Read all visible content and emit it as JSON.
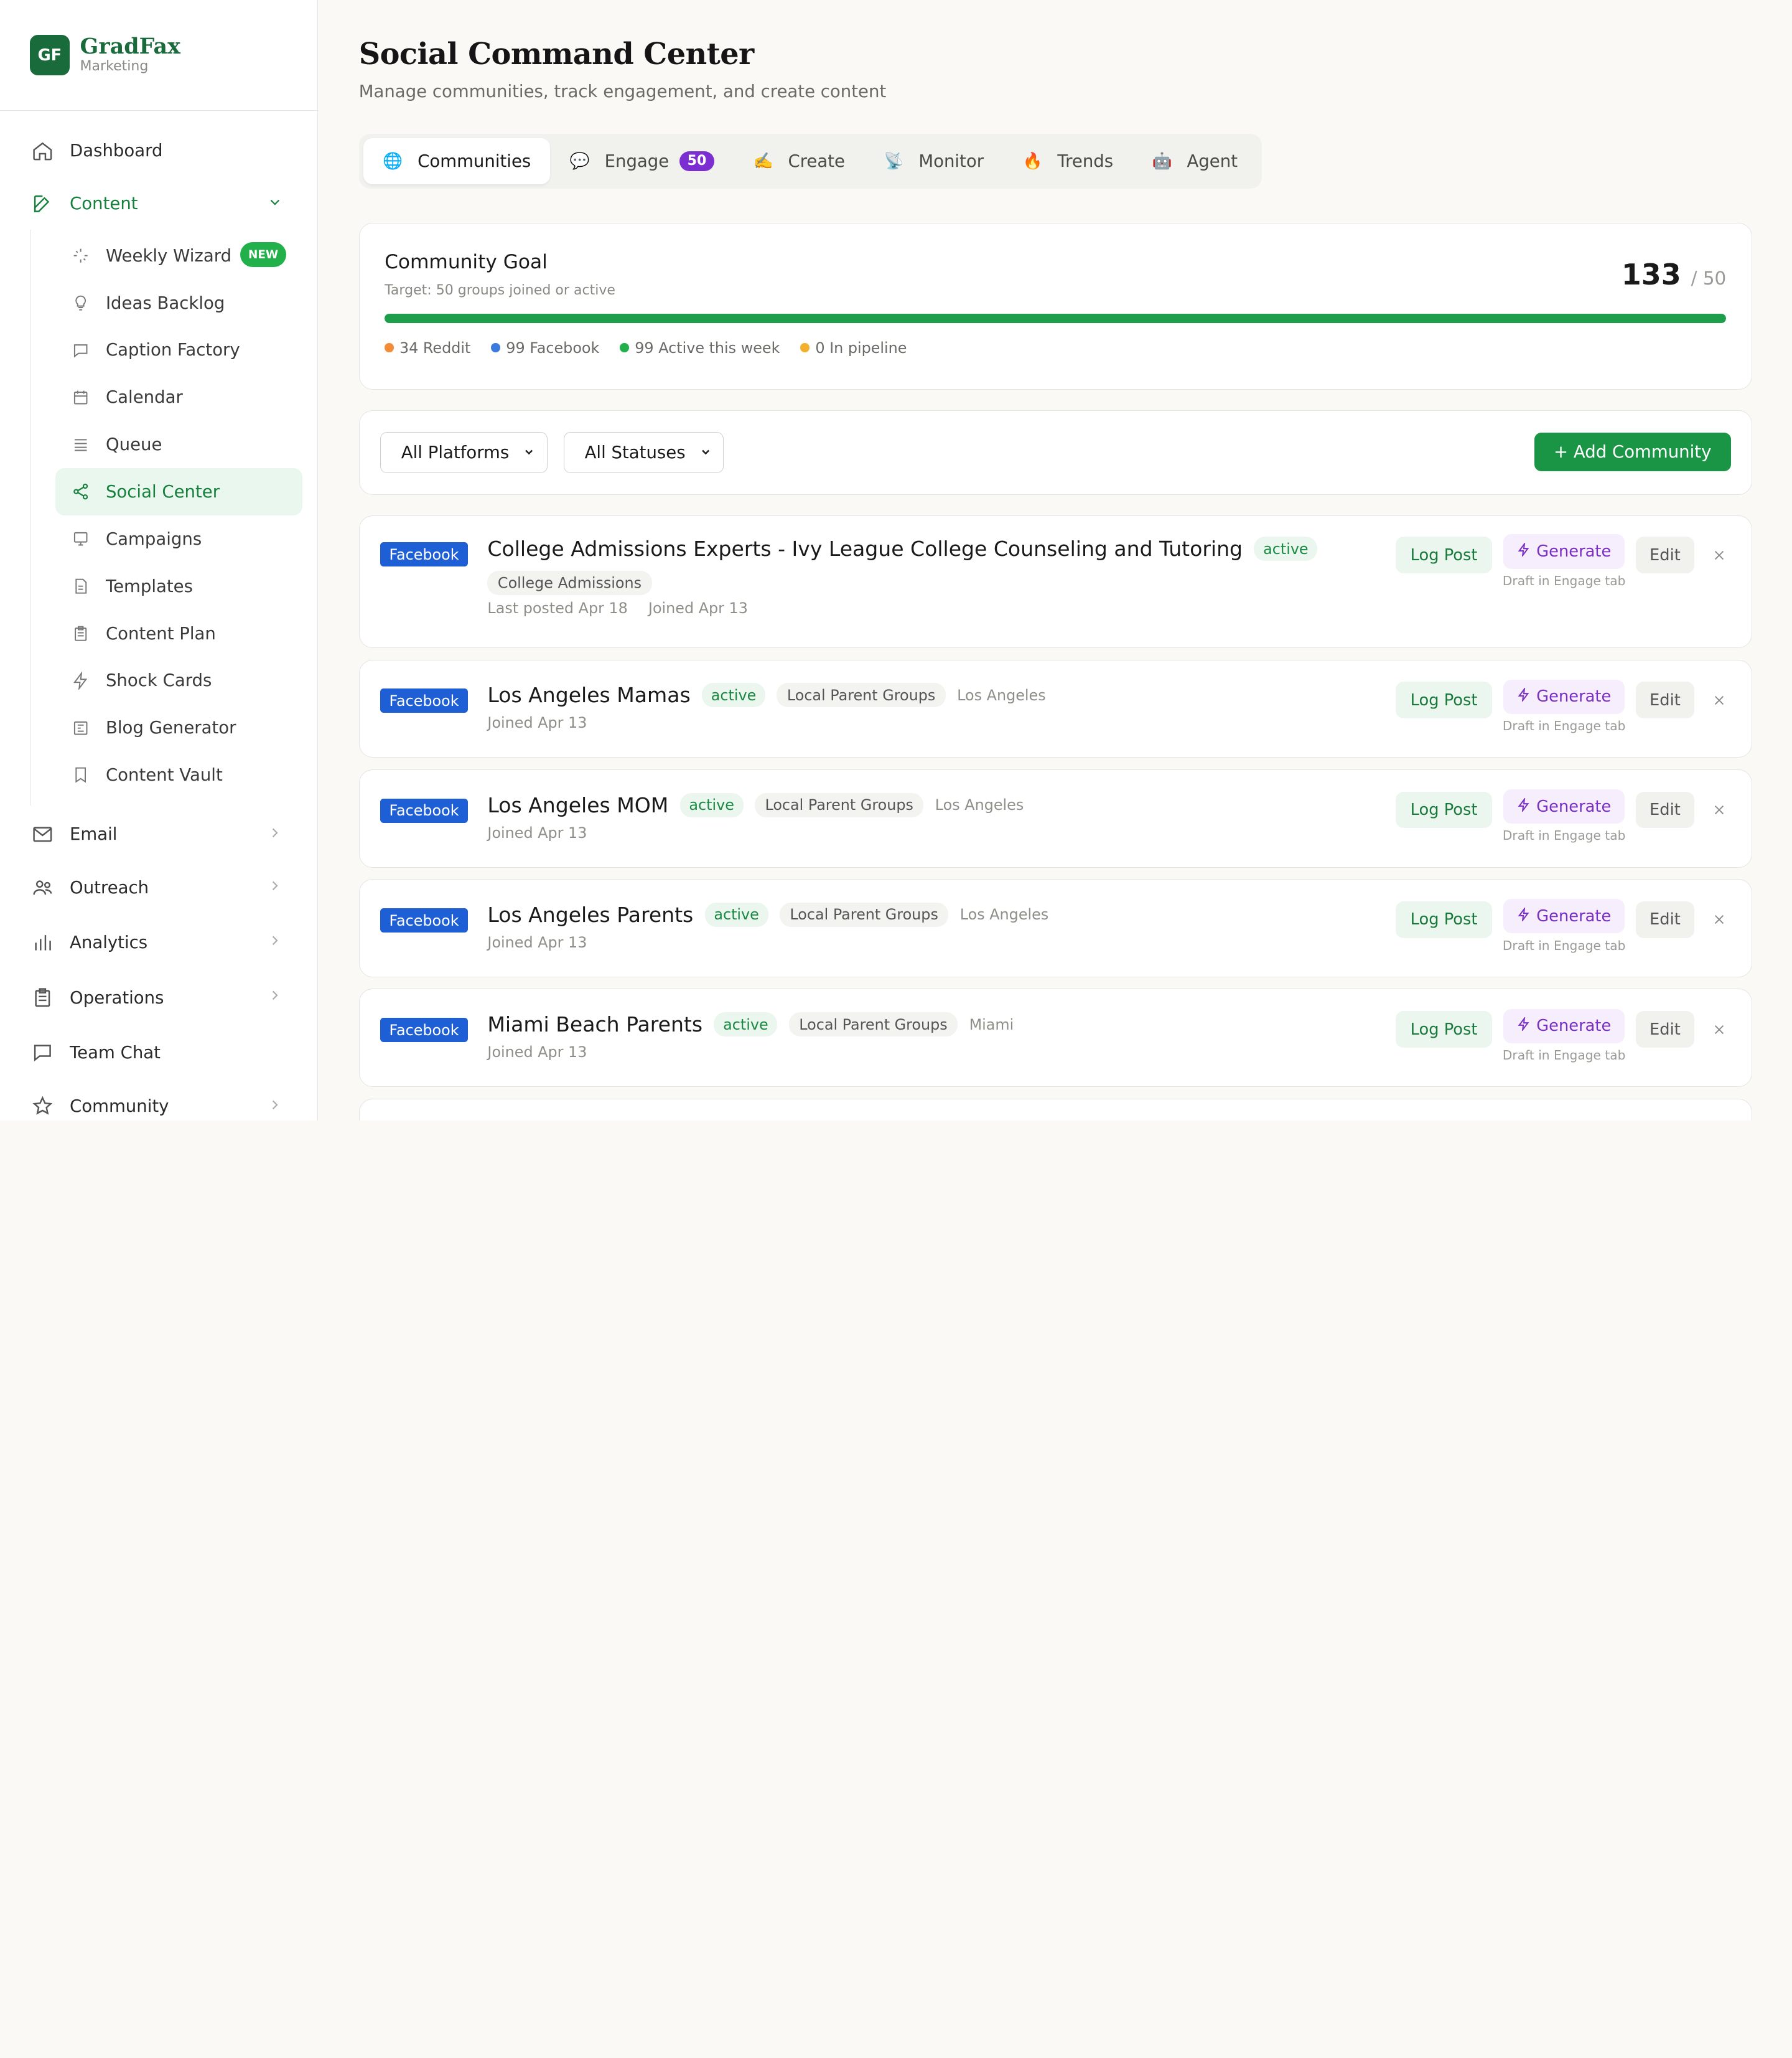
{
  "brand": {
    "logo": "GF",
    "name": "GradFax",
    "sub": "Marketing"
  },
  "nav": {
    "dashboard": "Dashboard",
    "content": "Content",
    "sub": [
      {
        "label": "Weekly Wizard",
        "icon": "sparkles-icon",
        "badge": "NEW"
      },
      {
        "label": "Ideas Backlog",
        "icon": "lightbulb-icon"
      },
      {
        "label": "Caption Factory",
        "icon": "chat-bubble-icon"
      },
      {
        "label": "Calendar",
        "icon": "calendar-icon"
      },
      {
        "label": "Queue",
        "icon": "list-icon"
      },
      {
        "label": "Social Center",
        "icon": "share-icon"
      },
      {
        "label": "Campaigns",
        "icon": "presentation-icon"
      },
      {
        "label": "Templates",
        "icon": "document-icon"
      },
      {
        "label": "Content Plan",
        "icon": "clipboard-icon"
      },
      {
        "label": "Shock Cards",
        "icon": "lightning-icon"
      },
      {
        "label": "Blog Generator",
        "icon": "newspaper-icon"
      },
      {
        "label": "Content Vault",
        "icon": "bookmark-icon"
      }
    ],
    "email": "Email",
    "outreach": "Outreach",
    "analytics": "Analytics",
    "operations": "Operations",
    "team_chat": "Team Chat",
    "community": "Community"
  },
  "header": {
    "title": "Social Command Center",
    "subtitle": "Manage communities, track engagement, and create content"
  },
  "tabs": [
    {
      "label": "Communities",
      "emoji": "🌐"
    },
    {
      "label": "Engage",
      "emoji": "💬",
      "count": "50"
    },
    {
      "label": "Create",
      "emoji": "✍️"
    },
    {
      "label": "Monitor",
      "emoji": "📡"
    },
    {
      "label": "Trends",
      "emoji": "🔥"
    },
    {
      "label": "Agent",
      "emoji": "🤖"
    }
  ],
  "goal": {
    "title": "Community Goal",
    "target": "Target: 50 groups joined or active",
    "current": "133",
    "total": "/ 50",
    "progress_fraction": 1.0,
    "legend": [
      {
        "label": "34 Reddit",
        "color": "#f28c38"
      },
      {
        "label": "99 Facebook",
        "color": "#3b7be0"
      },
      {
        "label": "99 Active this week",
        "color": "#22b04b"
      },
      {
        "label": "0 In pipeline",
        "color": "#f2b02c"
      }
    ]
  },
  "filters": {
    "platform": "All Platforms",
    "status": "All Statuses",
    "add_button": "+ Add Community"
  },
  "actions": {
    "log_post": "Log Post",
    "generate": "Generate",
    "generate_note": "Draft in Engage tab",
    "edit": "Edit",
    "close": "×"
  },
  "communities": [
    {
      "platform": "Facebook",
      "name": "College Admissions Experts - Ivy League College Counseling and Tutoring",
      "status": "active",
      "category": "College Admissions",
      "location": "",
      "last_posted": "Last posted Apr 18",
      "joined": "Joined Apr 13"
    },
    {
      "platform": "Facebook",
      "name": "Los Angeles Mamas",
      "status": "active",
      "category": "Local Parent Groups",
      "location": "Los Angeles",
      "joined": "Joined Apr 13"
    },
    {
      "platform": "Facebook",
      "name": "Los Angeles MOM",
      "status": "active",
      "category": "Local Parent Groups",
      "location": "Los Angeles",
      "joined": "Joined Apr 13"
    },
    {
      "platform": "Facebook",
      "name": "Los Angeles Parents",
      "status": "active",
      "category": "Local Parent Groups",
      "location": "Los Angeles",
      "joined": "Joined Apr 13"
    },
    {
      "platform": "Facebook",
      "name": "Miami Beach Parents",
      "status": "active",
      "category": "Local Parent Groups",
      "location": "Miami",
      "joined": "Joined Apr 13"
    }
  ]
}
